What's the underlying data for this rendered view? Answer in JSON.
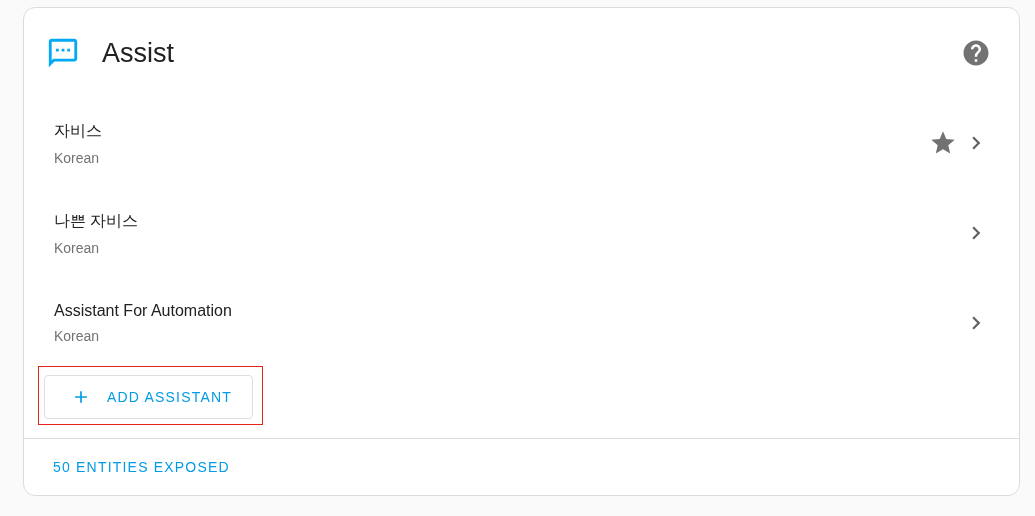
{
  "card": {
    "title": "Assist"
  },
  "assistants": [
    {
      "name": "자비스",
      "language": "Korean",
      "preferred": true
    },
    {
      "name": "나쁜 자비스",
      "language": "Korean",
      "preferred": false
    },
    {
      "name": "Assistant For Automation",
      "language": "Korean",
      "preferred": false
    }
  ],
  "add_button": {
    "label": "ADD ASSISTANT",
    "highlighted": true
  },
  "footer": {
    "link": "50 ENTITIES EXPOSED"
  }
}
